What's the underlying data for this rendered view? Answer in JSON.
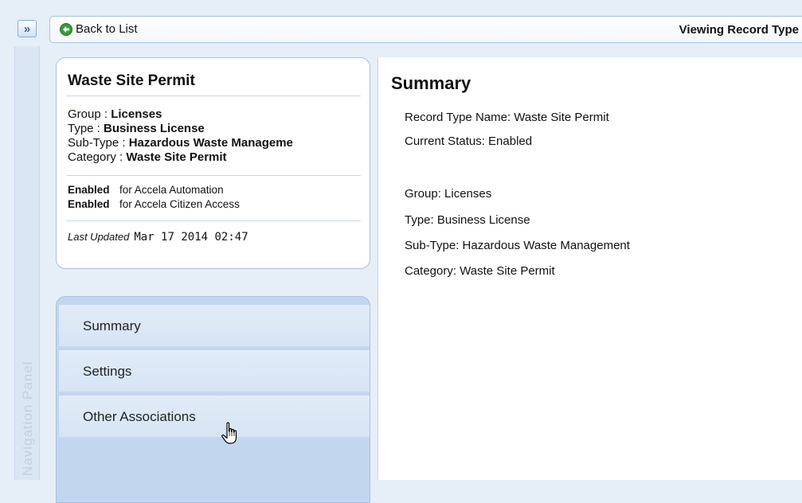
{
  "nav": {
    "toggle_glyph": "»",
    "panel_label": "Navigation Panel"
  },
  "toolbar": {
    "back_label": "Back to List",
    "view_title": "Viewing Record Type"
  },
  "record_card": {
    "title": "Waste Site Permit",
    "group_label": "Group : ",
    "group_value": "Licenses",
    "type_label": "Type : ",
    "type_value": "Business License",
    "subtype_label": "Sub-Type : ",
    "subtype_value": "Hazardous Waste Manageme",
    "category_label": "Category : ",
    "category_value": "Waste Site Permit",
    "status_aa_value": "Enabled",
    "status_aa_text": "for Accela Automation",
    "status_aca_value": "Enabled",
    "status_aca_text": "for Accela Citizen Access",
    "last_updated_label": "Last Updated",
    "last_updated_value": "Mar 17 2014 02:47"
  },
  "menu": {
    "items": [
      {
        "label": "Summary"
      },
      {
        "label": "Settings"
      },
      {
        "label": "Other Associations"
      }
    ]
  },
  "summary": {
    "heading": "Summary",
    "record_type_name": "Record Type Name:  Waste Site Permit",
    "current_status": "Current Status:  Enabled",
    "group": "Group:  Licenses",
    "type": "Type:  Business License",
    "subtype": "Sub-Type:  Hazardous Waste Management",
    "category": "Category:  Waste Site Permit"
  },
  "colors": {
    "accent_border": "#a9c2e0",
    "menu_bg": "#c2d6ee",
    "page_bg": "#e6eef8"
  }
}
